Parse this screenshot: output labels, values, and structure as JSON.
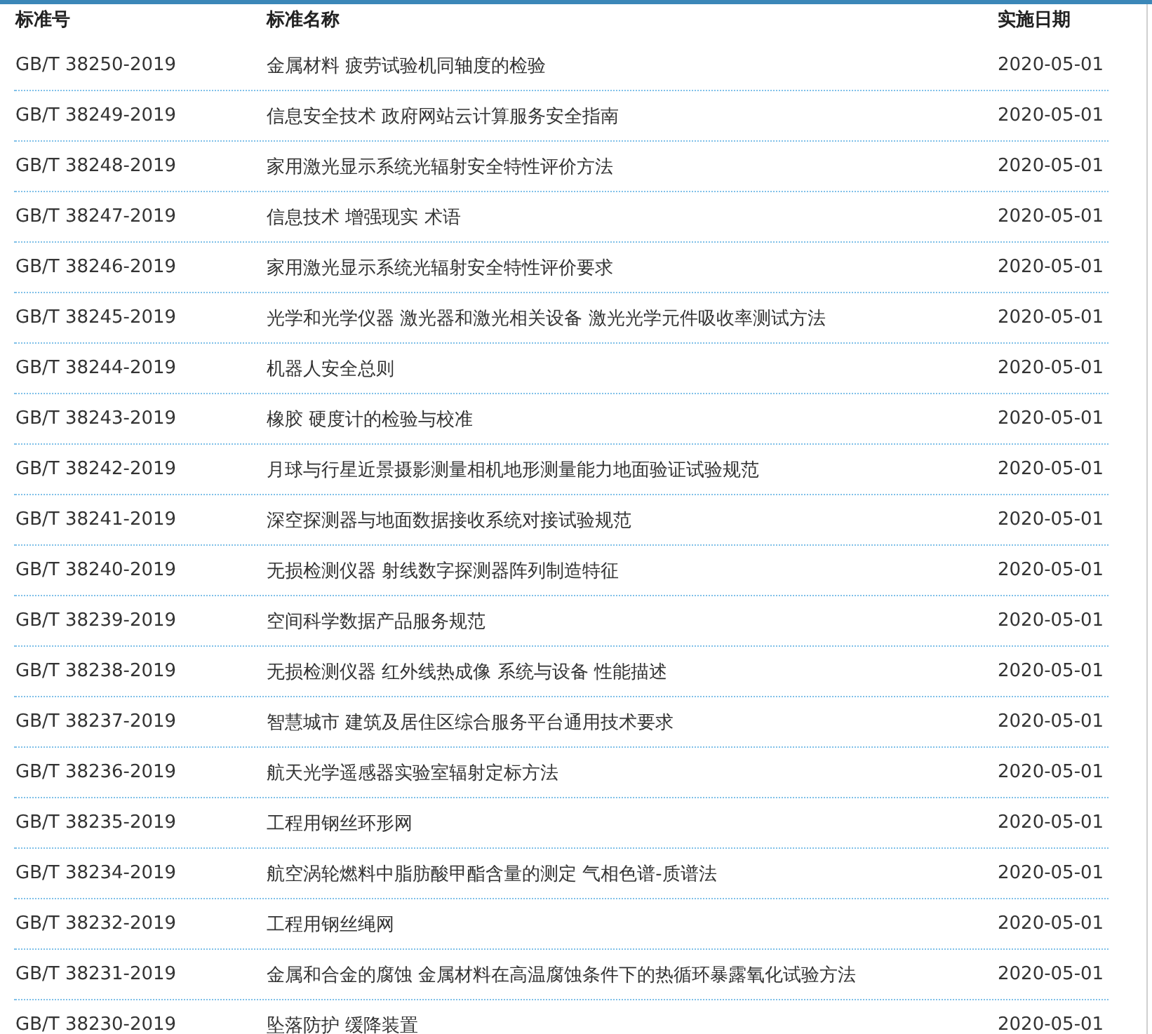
{
  "table": {
    "columns": [
      "标准号",
      "标准名称",
      "实施日期"
    ],
    "rows": [
      {
        "code": "GB/T 38250-2019",
        "name": "金属材料 疲劳试验机同轴度的检验",
        "date": "2020-05-01"
      },
      {
        "code": "GB/T 38249-2019",
        "name": "信息安全技术 政府网站云计算服务安全指南",
        "date": "2020-05-01"
      },
      {
        "code": "GB/T 38248-2019",
        "name": "家用激光显示系统光辐射安全特性评价方法",
        "date": "2020-05-01"
      },
      {
        "code": "GB/T 38247-2019",
        "name": "信息技术 增强现实 术语",
        "date": "2020-05-01"
      },
      {
        "code": "GB/T 38246-2019",
        "name": "家用激光显示系统光辐射安全特性评价要求",
        "date": "2020-05-01"
      },
      {
        "code": "GB/T 38245-2019",
        "name": "光学和光学仪器 激光器和激光相关设备 激光光学元件吸收率测试方法",
        "date": "2020-05-01"
      },
      {
        "code": "GB/T 38244-2019",
        "name": "机器人安全总则",
        "date": "2020-05-01"
      },
      {
        "code": "GB/T 38243-2019",
        "name": "橡胶 硬度计的检验与校准",
        "date": "2020-05-01"
      },
      {
        "code": "GB/T 38242-2019",
        "name": "月球与行星近景摄影测量相机地形测量能力地面验证试验规范",
        "date": "2020-05-01"
      },
      {
        "code": "GB/T 38241-2019",
        "name": "深空探测器与地面数据接收系统对接试验规范",
        "date": "2020-05-01"
      },
      {
        "code": "GB/T 38240-2019",
        "name": "无损检测仪器 射线数字探测器阵列制造特征",
        "date": "2020-05-01"
      },
      {
        "code": "GB/T 38239-2019",
        "name": "空间科学数据产品服务规范",
        "date": "2020-05-01"
      },
      {
        "code": "GB/T 38238-2019",
        "name": "无损检测仪器 红外线热成像 系统与设备 性能描述",
        "date": "2020-05-01"
      },
      {
        "code": "GB/T 38237-2019",
        "name": "智慧城市 建筑及居住区综合服务平台通用技术要求",
        "date": "2020-05-01"
      },
      {
        "code": "GB/T 38236-2019",
        "name": "航天光学遥感器实验室辐射定标方法",
        "date": "2020-05-01"
      },
      {
        "code": "GB/T 38235-2019",
        "name": "工程用钢丝环形网",
        "date": "2020-05-01"
      },
      {
        "code": "GB/T 38234-2019",
        "name": "航空涡轮燃料中脂肪酸甲酯含量的测定 气相色谱-质谱法",
        "date": "2020-05-01"
      },
      {
        "code": "GB/T 38232-2019",
        "name": "工程用钢丝绳网",
        "date": "2020-05-01"
      },
      {
        "code": "GB/T 38231-2019",
        "name": "金属和合金的腐蚀 金属材料在高温腐蚀条件下的热循环暴露氧化试验方法",
        "date": "2020-05-01"
      },
      {
        "code": "GB/T 38230-2019",
        "name": "坠落防护 缓降装置",
        "date": "2020-05-01"
      }
    ]
  }
}
